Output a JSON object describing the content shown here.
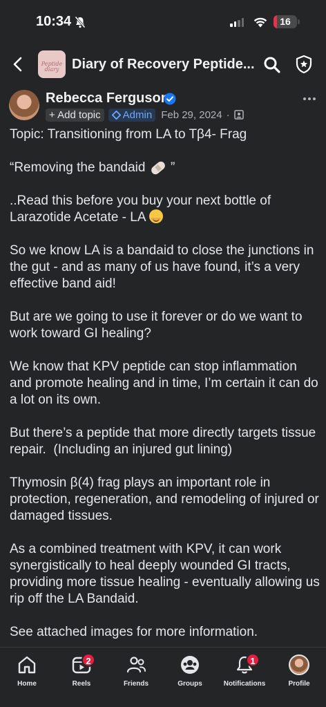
{
  "status_bar": {
    "time": "10:34",
    "battery": "16",
    "battery_level": 0.16,
    "signal_bars": 2,
    "colors": {
      "battery_low": "#e5334a"
    }
  },
  "header": {
    "group_title": "Diary of Recovery Peptide...",
    "group_thumb_line1": "Peptide",
    "group_thumb_line2": "diary"
  },
  "post": {
    "author": "Rebecca Ferguson",
    "add_topic": "+ Add topic",
    "admin_badge": "Admin",
    "date": "Feb 29, 2024",
    "separator": "·",
    "paragraphs": [
      "Topic: Transitioning from LA to Tβ4- Frag",
      "“Removing the bandaid",
      "..Read this before you buy your next bottle of Larazotide Acetate - LA",
      "So we know LA is a bandaid to close the junctions in the gut - and as many of us have found, it’s a very effective band aid!",
      "But are we going to use it forever or do we want to work toward GI healing?",
      "We know that KPV peptide can stop inflammation and promote healing and in time, I’m certain it can do a lot on its own.",
      "But there’s a peptide that more directly targets tissue repair.  (Including an injured gut lining)",
      "Thymosin β(4) frag plays an important role in protection, regeneration, and remodeling of injured or damaged tissues.",
      "As a combined treatment with KPV, it can work synergistically to heal deeply wounded GI tracts, providing more tissue healing - eventually allowing us rip off the LA Bandaid.",
      "See attached images for more information."
    ],
    "bandaid_close": " ”"
  },
  "nav": {
    "items": [
      {
        "label": "Home",
        "icon": "home-icon"
      },
      {
        "label": "Reels",
        "icon": "reels-icon",
        "badge": "2"
      },
      {
        "label": "Friends",
        "icon": "friends-icon"
      },
      {
        "label": "Groups",
        "icon": "groups-icon",
        "active": true
      },
      {
        "label": "Notifications",
        "icon": "bell-icon",
        "badge": "1"
      },
      {
        "label": "Profile",
        "icon": "profile-avatar"
      }
    ],
    "colors": {
      "badge": "#e41e3f"
    }
  }
}
